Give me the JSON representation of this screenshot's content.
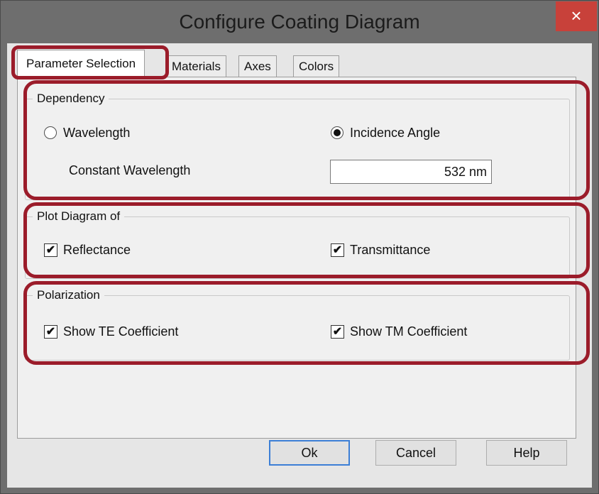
{
  "window": {
    "title": "Configure Coating Diagram",
    "close_glyph": "×"
  },
  "tabs": [
    {
      "label": "Parameter Selection",
      "active": true
    },
    {
      "label": "Materials"
    },
    {
      "label": "Axes"
    },
    {
      "label": "Colors"
    }
  ],
  "dependency": {
    "title": "Dependency",
    "options": [
      {
        "label": "Wavelength",
        "selected": false
      },
      {
        "label": "Incidence Angle",
        "selected": true
      }
    ],
    "constant_label": "Constant Wavelength",
    "constant_value": "532 nm"
  },
  "plot": {
    "title": "Plot Diagram of",
    "reflectance": {
      "label": "Reflectance",
      "checked": true
    },
    "transmittance": {
      "label": "Transmittance",
      "checked": true
    }
  },
  "polarization": {
    "title": "Polarization",
    "te": {
      "label": "Show TE Coefficient",
      "checked": true
    },
    "tm": {
      "label": "Show TM Coefficient",
      "checked": true
    }
  },
  "buttons": {
    "ok": "Ok",
    "cancel": "Cancel",
    "help": "Help"
  },
  "check_glyph": "✔",
  "colors": {
    "highlight": "#9b1c2a",
    "titlebar": "#6e6e6e",
    "close": "#c8413a",
    "default_button_border": "#3c7fd6"
  }
}
